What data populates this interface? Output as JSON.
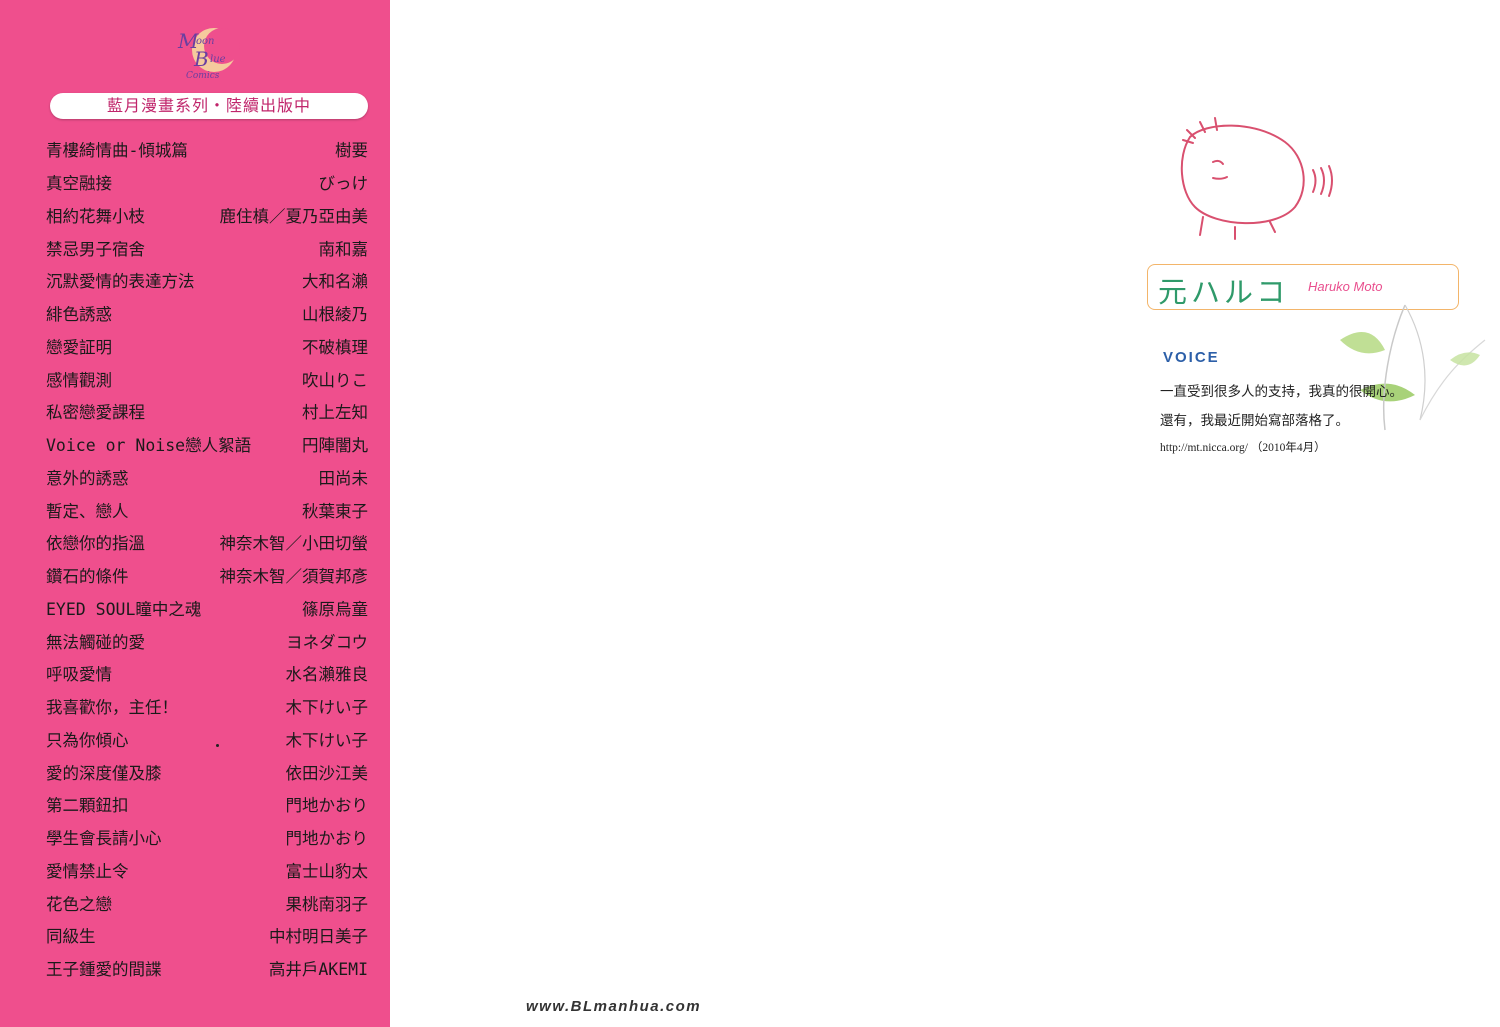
{
  "flap": {
    "logo_text": "Moon Blue Comics",
    "series_banner": "藍月漫畫系列・陸續出版中",
    "books": [
      {
        "title": "青樓綺情曲-傾城篇",
        "author": "樹要"
      },
      {
        "title": "真空融接",
        "author": "びっけ"
      },
      {
        "title": "相約花舞小枝",
        "author": "鹿住槙／夏乃亞由美"
      },
      {
        "title": "禁忌男子宿舍",
        "author": "南和嘉"
      },
      {
        "title": "沉默愛情的表達方法",
        "author": "大和名瀨"
      },
      {
        "title": "緋色誘惑",
        "author": "山根綾乃"
      },
      {
        "title": "戀愛証明",
        "author": "不破槙理"
      },
      {
        "title": "感情觀測",
        "author": "吹山りこ"
      },
      {
        "title": "私密戀愛課程",
        "author": "村上左知"
      },
      {
        "title": "Voice or Noise戀人絮語",
        "author": "円陣闇丸"
      },
      {
        "title": "意外的誘惑",
        "author": "田尚未"
      },
      {
        "title": "暫定、戀人",
        "author": "秋葉東子"
      },
      {
        "title": "依戀你的指溫",
        "author": "神奈木智／小田切螢"
      },
      {
        "title": "鑽石的條件",
        "author": "神奈木智／須賀邦彥"
      },
      {
        "title": "EYED SOUL瞳中之魂",
        "author": "篠原烏童"
      },
      {
        "title": "無法觸碰的愛",
        "author": "ヨネダコウ"
      },
      {
        "title": "呼吸愛情",
        "author": "水名瀨雅良"
      },
      {
        "title": "我喜歡你，主任！",
        "author": "木下けい子"
      },
      {
        "title": "只為你傾心",
        "author": "木下けい子"
      },
      {
        "title": "愛的深度僅及膝",
        "author": "依田沙江美"
      },
      {
        "title": "第二顆鈕扣",
        "author": "門地かおり"
      },
      {
        "title": "學生會長請小心",
        "author": "門地かおり"
      },
      {
        "title": "愛情禁止令",
        "author": "富士山豹太"
      },
      {
        "title": "花色之戀",
        "author": "果桃南羽子"
      },
      {
        "title": "同級生",
        "author": "中村明日美子"
      },
      {
        "title": "王子鍾愛的間諜",
        "author": "高井戶AKEMI"
      }
    ]
  },
  "author": {
    "name_jp": "元ハルコ",
    "name_en": "Haruko Moto",
    "voice_label": "VOICE",
    "voice_line1": "一直受到很多人的支持，我真的很開心。",
    "voice_line2": "還有，我最近開始寫部落格了。",
    "voice_url": "http://mt.nicca.org/ （2010年4月）"
  },
  "footer": {
    "site": "www.BLmanhua.com"
  },
  "colors": {
    "flap_pink": "#ef4f8d",
    "name_green": "#2f9a6a",
    "name_pink": "#e94f8e",
    "voice_blue": "#2c5fa8",
    "box_border": "#f3b56a"
  }
}
